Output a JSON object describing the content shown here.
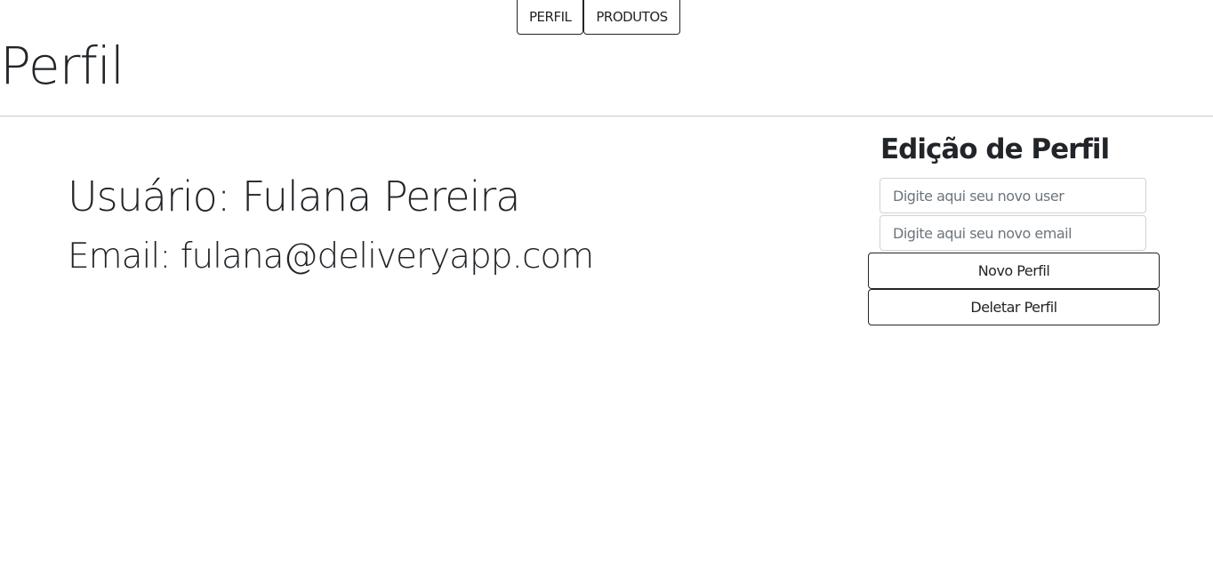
{
  "nav": {
    "perfil": "PERFIL",
    "produtos": "PRODUTOS"
  },
  "header": {
    "title": "Perfil"
  },
  "profile": {
    "user": "Usuário: Fulana Pereira",
    "email": "Email: fulana@deliveryapp.com"
  },
  "edit": {
    "title": "Edição de Perfil",
    "user_placeholder": "Digite aqui seu novo user",
    "email_placeholder": "Digite aqui seu novo email",
    "new_button": "Novo Perfil",
    "delete_button": "Deletar Perfil"
  }
}
